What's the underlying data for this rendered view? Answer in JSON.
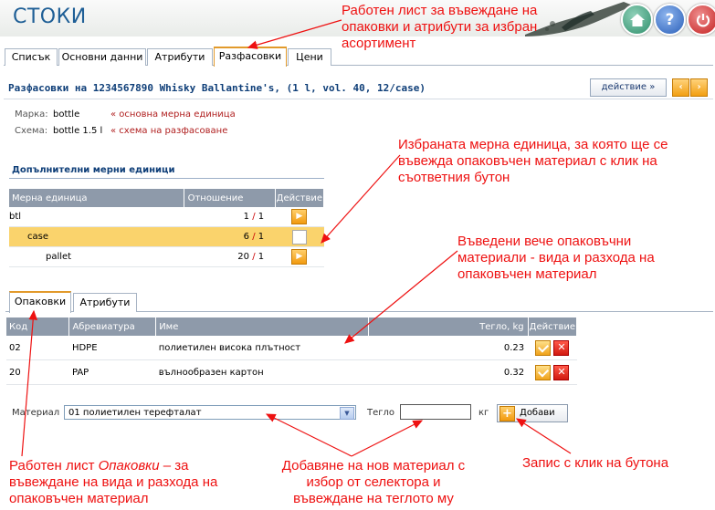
{
  "header": {
    "title": "СТОКИ"
  },
  "icons": {
    "home": "home-icon",
    "help": "help-icon",
    "power": "power-icon"
  },
  "tabs": [
    {
      "label": "Списък"
    },
    {
      "label": "Основни данни"
    },
    {
      "label": "Атрибути"
    },
    {
      "label": "Разфасовки",
      "active": true
    },
    {
      "label": "Цени"
    }
  ],
  "section": {
    "title": "Разфасовки на 1234567890 Whisky Ballantine's, (1 l, vol. 40, 12/case)",
    "action_label": "действие  »",
    "prev_label": "‹",
    "next_label": "›"
  },
  "info": {
    "brand_label": "Марка:",
    "brand_value": "bottle",
    "brand_note": "« основна мерна единица",
    "scheme_label": "Схема:",
    "scheme_value": "bottle 1.5 l",
    "scheme_note": "« схема на разфасоване"
  },
  "additional_units": {
    "title": "Допълнителни мерни единици",
    "headers": [
      "Мерна единица",
      "Отношение",
      "Действие"
    ],
    "rows": [
      {
        "unit": "btl",
        "num": "1",
        "den": "1"
      },
      {
        "unit": "case",
        "num": "6",
        "den": "1",
        "selected": true
      },
      {
        "unit": "pallet",
        "num": "20",
        "den": "1"
      }
    ]
  },
  "subtabs": [
    {
      "label": "Опаковки",
      "active": true
    },
    {
      "label": "Атрибути"
    }
  ],
  "packaging": {
    "headers": [
      "Код",
      "Абревиатура",
      "Име",
      "Тегло, kg",
      "Действие"
    ],
    "rows": [
      {
        "code": "02",
        "abbr": "HDPE",
        "name": "полиетилен висока плътност",
        "weight": "0.23"
      },
      {
        "code": "20",
        "abbr": "PAP",
        "name": "вълнообразен картон",
        "weight": "0.32"
      }
    ]
  },
  "form": {
    "material_label": "Материал",
    "material_value": "01 полиетилен терефталат",
    "weight_label": "Тегло",
    "weight_value": "",
    "unit_label": "кг",
    "add_label": "Добави"
  },
  "annotations": {
    "a1": "Работен лист за въвеждане на опаковки и атрибути за избран асортимент",
    "a2": "Избраната мерна единица, за която ще се въвежда опаковъчен материал с клик на съответния бутон",
    "a3": "Въведени вече опаковъчни материали - вида и разхода на опаковъчен материал",
    "a4_pre": "Работен лист ",
    "a4_em": "Опаковки",
    "a4_post": " – за въвеждане на вида и разхода на опаковъчен материал",
    "a5": "Добавяне на нов материал с избор от селектора и въвеждане на теглото му",
    "a6": "Запис с клик на бутона"
  }
}
